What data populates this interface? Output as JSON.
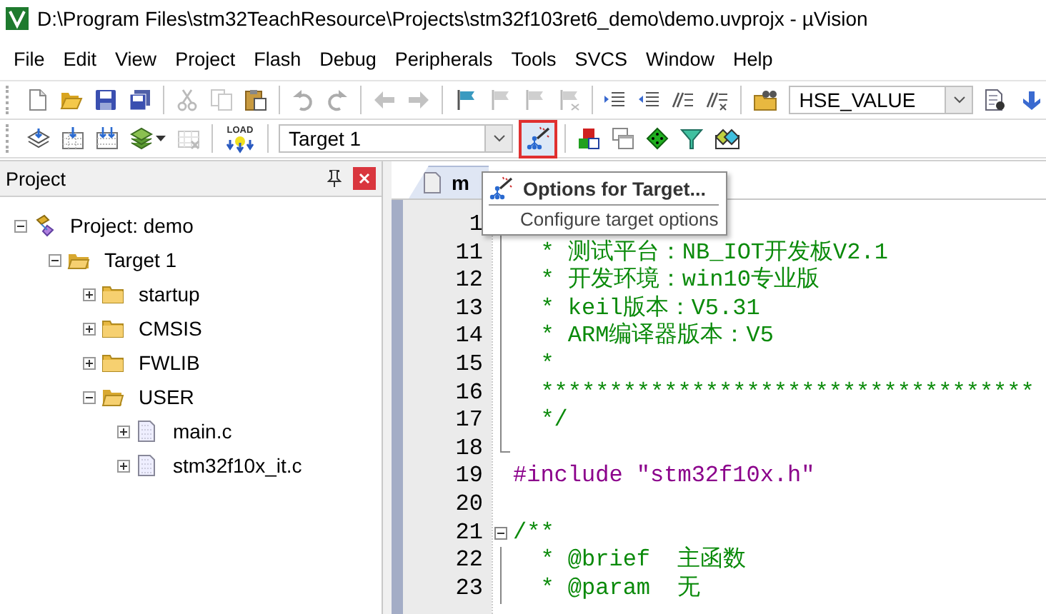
{
  "window": {
    "title": "D:\\Program Files\\stm32TeachResource\\Projects\\stm32f103ret6_demo\\demo.uvprojx - µVision"
  },
  "menu": [
    "File",
    "Edit",
    "View",
    "Project",
    "Flash",
    "Debug",
    "Peripherals",
    "Tools",
    "SVCS",
    "Window",
    "Help"
  ],
  "toolbar_1": [
    {
      "kind": "new",
      "disabled": false
    },
    {
      "kind": "open",
      "disabled": false
    },
    {
      "kind": "save",
      "disabled": false
    },
    {
      "kind": "saveall",
      "disabled": false
    },
    {
      "kind": "sep"
    },
    {
      "kind": "cut",
      "disabled": true
    },
    {
      "kind": "copy",
      "disabled": true
    },
    {
      "kind": "paste",
      "disabled": false
    },
    {
      "kind": "sep"
    },
    {
      "kind": "undo",
      "disabled": true
    },
    {
      "kind": "redo",
      "disabled": true
    },
    {
      "kind": "sep"
    },
    {
      "kind": "back",
      "disabled": true
    },
    {
      "kind": "forward",
      "disabled": true
    },
    {
      "kind": "sep"
    },
    {
      "kind": "flag",
      "disabled": false
    },
    {
      "kind": "flagprev",
      "disabled": true
    },
    {
      "kind": "flagnext",
      "disabled": true
    },
    {
      "kind": "flagclear",
      "disabled": true
    },
    {
      "kind": "sep"
    },
    {
      "kind": "indent",
      "disabled": false
    },
    {
      "kind": "outdent",
      "disabled": false
    },
    {
      "kind": "comment",
      "disabled": false
    },
    {
      "kind": "uncomment",
      "disabled": false
    },
    {
      "kind": "sep"
    },
    {
      "kind": "findfolder",
      "disabled": false
    },
    {
      "kind": "combo",
      "value": "HSE_VALUE"
    },
    {
      "kind": "finddoc",
      "disabled": false
    },
    {
      "kind": "debugarrow",
      "disabled": false
    }
  ],
  "toolbar_2": [
    {
      "kind": "translate",
      "disabled": false
    },
    {
      "kind": "build",
      "disabled": false
    },
    {
      "kind": "rebuild",
      "disabled": false
    },
    {
      "kind": "batch",
      "disabled": false
    },
    {
      "kind": "stop",
      "disabled": true
    },
    {
      "kind": "sep"
    },
    {
      "kind": "load",
      "text": "LOAD",
      "disabled": false
    },
    {
      "kind": "sep"
    },
    {
      "kind": "combo",
      "value": "Target 1"
    },
    {
      "kind": "options",
      "disabled": false,
      "highlighted": true
    },
    {
      "kind": "sep"
    },
    {
      "kind": "manage",
      "disabled": false
    },
    {
      "kind": "windows",
      "disabled": false
    },
    {
      "kind": "diamond",
      "disabled": false
    },
    {
      "kind": "funnel",
      "disabled": false
    },
    {
      "kind": "packs",
      "disabled": false
    }
  ],
  "project_panel": {
    "title": "Project",
    "tree": [
      {
        "label": "Project: demo",
        "kind": "project",
        "expanded": true,
        "children": [
          {
            "label": "Target 1",
            "kind": "target",
            "expanded": true,
            "children": [
              {
                "label": "startup",
                "kind": "group",
                "expanded": false
              },
              {
                "label": "CMSIS",
                "kind": "group",
                "expanded": false
              },
              {
                "label": "FWLIB",
                "kind": "group",
                "expanded": false
              },
              {
                "label": "USER",
                "kind": "group",
                "expanded": true,
                "children": [
                  {
                    "label": "main.c",
                    "kind": "file",
                    "expanded": false
                  },
                  {
                    "label": "stm32f10x_it.c",
                    "kind": "file",
                    "expanded": false
                  }
                ]
              }
            ]
          }
        ]
      }
    ]
  },
  "editor": {
    "tab": {
      "label": "m",
      "selected": true
    },
    "lines": [
      {
        "num": "1",
        "kind": "comment",
        "fold_box": false,
        "fold_guide": true,
        "fold_end": false
      },
      {
        "num": "11",
        "text": "  * 测试平台：NB_IOT开发板V2.1",
        "kind": "comment",
        "fold_box": false,
        "fold_guide": true,
        "fold_end": false
      },
      {
        "num": "12",
        "text": "  * 开发环境：win10专业版",
        "kind": "comment",
        "fold_box": false,
        "fold_guide": true,
        "fold_end": false
      },
      {
        "num": "13",
        "text": "  * keil版本：V5.31",
        "kind": "comment",
        "fold_box": false,
        "fold_guide": true,
        "fold_end": false
      },
      {
        "num": "14",
        "text": "  * ARM编译器版本：V5",
        "kind": "comment",
        "fold_box": false,
        "fold_guide": true,
        "fold_end": false
      },
      {
        "num": "15",
        "text": "  *",
        "kind": "comment",
        "fold_box": false,
        "fold_guide": true,
        "fold_end": false
      },
      {
        "num": "16",
        "text": "  ************************************",
        "kind": "comment",
        "fold_box": false,
        "fold_guide": true,
        "fold_end": false
      },
      {
        "num": "17",
        "text": "  */",
        "kind": "comment",
        "fold_box": false,
        "fold_guide": true,
        "fold_end": false
      },
      {
        "num": "18",
        "kind": "blank",
        "fold_box": false,
        "fold_guide": false,
        "fold_end": true
      },
      {
        "num": "19",
        "text": "#include \"stm32f10x.h\"",
        "kind": "preproc",
        "fold_box": false,
        "fold_guide": false,
        "fold_end": false
      },
      {
        "num": "20",
        "kind": "blank",
        "fold_box": false,
        "fold_guide": false,
        "fold_end": false
      },
      {
        "num": "21",
        "text": "/**",
        "kind": "comment",
        "fold_box": true,
        "fold_guide": false,
        "fold_end": false
      },
      {
        "num": "22",
        "text": "  * @brief  主函数",
        "kind": "comment",
        "fold_box": false,
        "fold_guide": true,
        "fold_end": false
      },
      {
        "num": "23",
        "text": "  * @param  无",
        "kind": "comment",
        "fold_box": false,
        "fold_guide": true,
        "fold_end": false
      }
    ]
  },
  "tooltip": {
    "title": "Options for Target...",
    "description": "Configure target options"
  }
}
